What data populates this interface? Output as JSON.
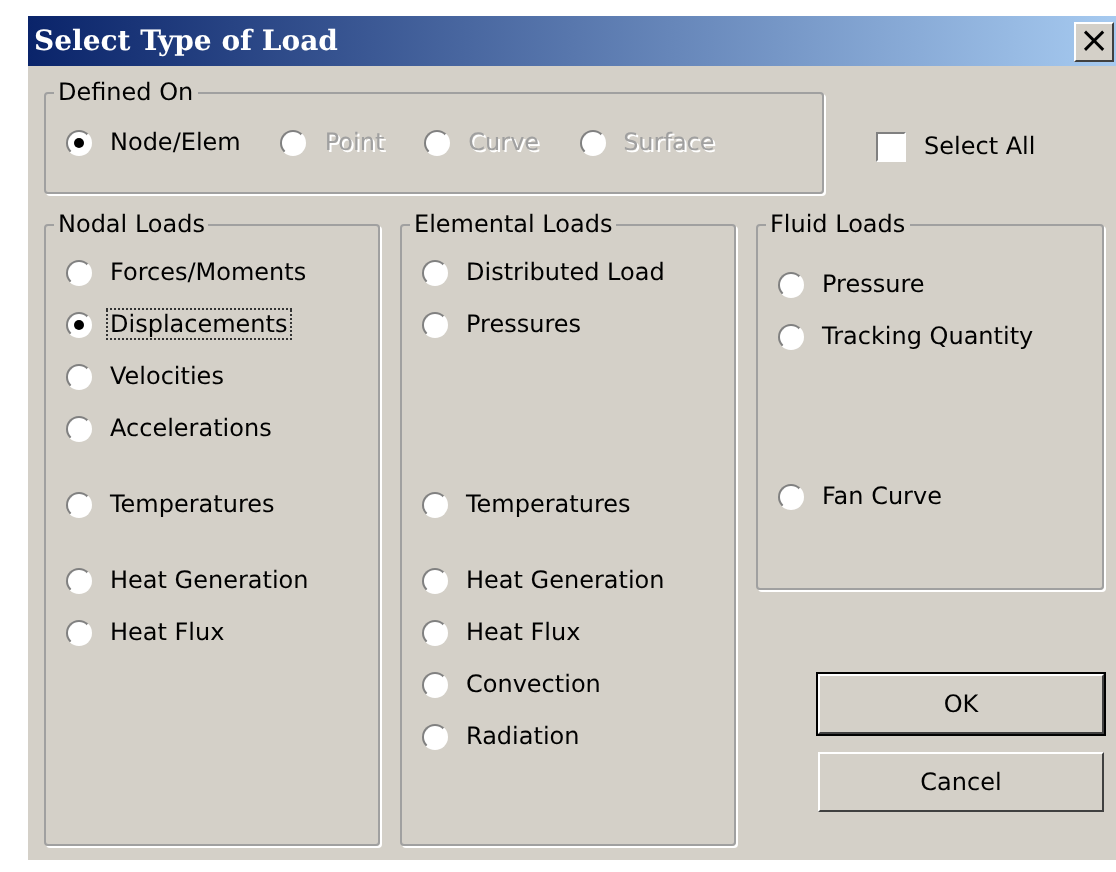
{
  "window": {
    "title": "Select Type of Load",
    "close": "×"
  },
  "defined_on": {
    "title": "Defined On",
    "options": [
      {
        "label": "Node/Elem",
        "selected": true,
        "disabled": false
      },
      {
        "label": "Point",
        "selected": false,
        "disabled": true
      },
      {
        "label": "Curve",
        "selected": false,
        "disabled": true
      },
      {
        "label": "Surface",
        "selected": false,
        "disabled": true
      }
    ]
  },
  "select_all": {
    "label": "Select All",
    "checked": false
  },
  "groups": [
    {
      "title": "Nodal Loads",
      "options": [
        {
          "label": "Forces/Moments",
          "selected": false,
          "focused": false
        },
        {
          "label": "Displacements",
          "selected": true,
          "focused": true
        },
        {
          "label": "Velocities",
          "selected": false,
          "focused": false
        },
        {
          "label": "Accelerations",
          "selected": false,
          "focused": false
        },
        {
          "label": "Temperatures",
          "selected": false,
          "focused": false
        },
        {
          "label": "Heat Generation",
          "selected": false,
          "focused": false
        },
        {
          "label": "Heat Flux",
          "selected": false,
          "focused": false
        }
      ]
    },
    {
      "title": "Elemental Loads",
      "options": [
        {
          "label": "Distributed Load",
          "selected": false,
          "focused": false
        },
        {
          "label": "Pressures",
          "selected": false,
          "focused": false
        },
        {
          "label": "Temperatures",
          "selected": false,
          "focused": false
        },
        {
          "label": "Heat Generation",
          "selected": false,
          "focused": false
        },
        {
          "label": "Heat Flux",
          "selected": false,
          "focused": false
        },
        {
          "label": "Convection",
          "selected": false,
          "focused": false
        },
        {
          "label": "Radiation",
          "selected": false,
          "focused": false
        }
      ]
    },
    {
      "title": "Fluid Loads",
      "options": [
        {
          "label": "Pressure",
          "selected": false,
          "focused": false
        },
        {
          "label": "Tracking Quantity",
          "selected": false,
          "focused": false
        },
        {
          "label": "Fan Curve",
          "selected": false,
          "focused": false
        }
      ]
    }
  ],
  "buttons": [
    {
      "label": "OK",
      "default": true
    },
    {
      "label": "Cancel",
      "default": false
    }
  ]
}
